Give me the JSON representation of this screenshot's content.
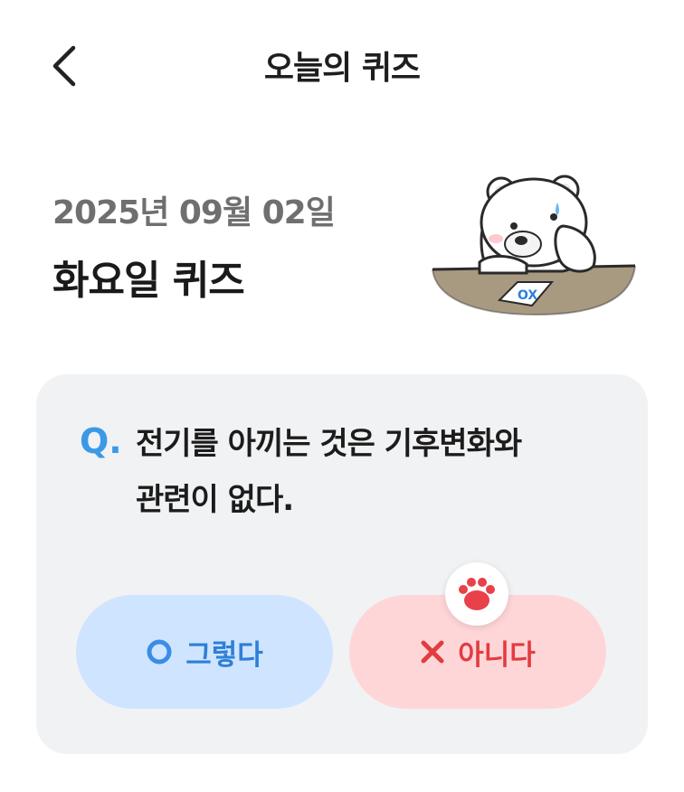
{
  "header": {
    "back_icon": "chevron-left-icon",
    "title": "오늘의 퀴즈"
  },
  "quiz": {
    "date": "2025년 09월 02일",
    "title": "화요일 퀴즈",
    "card_label": "OX"
  },
  "question": {
    "marker": "Q.",
    "line1": "전기를 아끼는 것은 기후변화와",
    "line2": "관련이 없다."
  },
  "answers": {
    "yes": {
      "icon": "circle-o-icon",
      "label": "그렇다",
      "color": "#2d7fd9",
      "bg": "#cfe4ff"
    },
    "no": {
      "icon": "x-icon",
      "label": "아니다",
      "color": "#e23c40",
      "bg": "#ffd6d8"
    }
  },
  "colors": {
    "accent": "#3a9ae6",
    "card_bg": "#f1f2f4"
  }
}
